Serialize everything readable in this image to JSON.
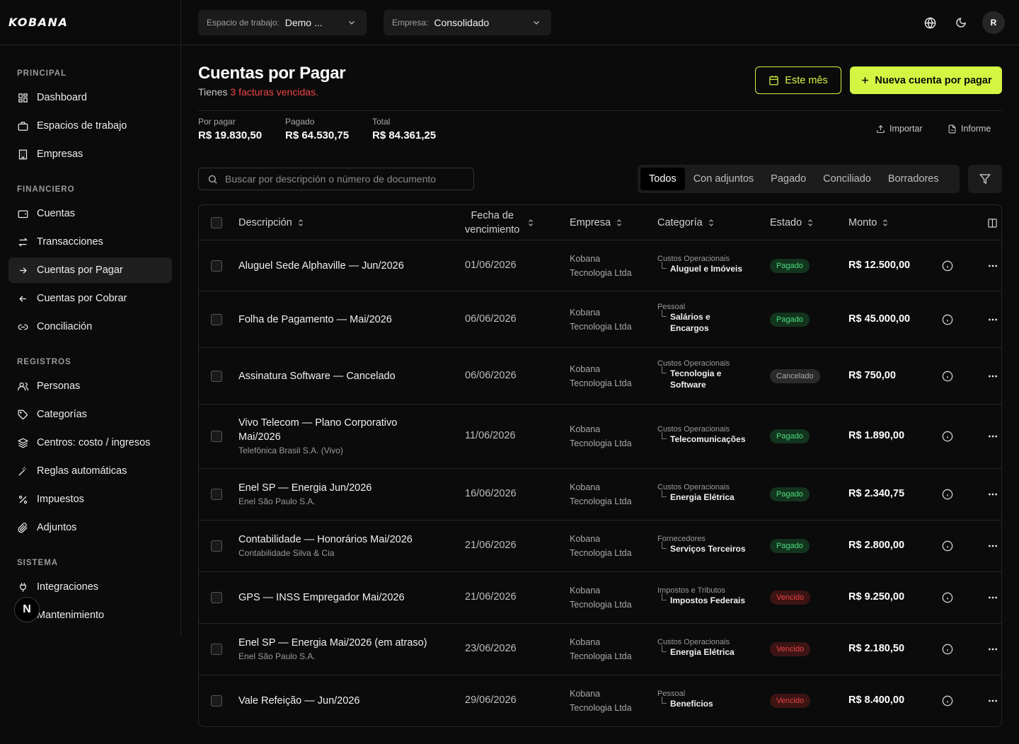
{
  "topbar": {
    "logo": "KOBANA",
    "workspace_label": "Espacio de trabajo:",
    "workspace_value": "Demo ...",
    "company_label": "Empresa:",
    "company_value": "Consolidado",
    "avatar_initial": "R"
  },
  "sidebar": {
    "sections": [
      {
        "title": "PRINCIPAL",
        "items": [
          {
            "label": "Dashboard",
            "icon": "dashboard-icon"
          },
          {
            "label": "Espacios de trabajo",
            "icon": "briefcase-icon"
          },
          {
            "label": "Empresas",
            "icon": "building-icon"
          }
        ]
      },
      {
        "title": "FINANCIERO",
        "items": [
          {
            "label": "Cuentas",
            "icon": "wallet-icon"
          },
          {
            "label": "Transacciones",
            "icon": "transfer-icon"
          },
          {
            "label": "Cuentas por Pagar",
            "icon": "arrow-right-icon",
            "active": true
          },
          {
            "label": "Cuentas por Cobrar",
            "icon": "arrow-left-icon"
          },
          {
            "label": "Conciliación",
            "icon": "link-icon"
          }
        ]
      },
      {
        "title": "REGISTROS",
        "items": [
          {
            "label": "Personas",
            "icon": "users-icon"
          },
          {
            "label": "Categorías",
            "icon": "tag-icon"
          },
          {
            "label": "Centros: costo / ingresos",
            "icon": "layers-icon"
          },
          {
            "label": "Reglas automáticas",
            "icon": "wand-icon"
          },
          {
            "label": "Impuestos",
            "icon": "percent-icon"
          },
          {
            "label": "Adjuntos",
            "icon": "paperclip-icon"
          }
        ]
      },
      {
        "title": "SISTEMA",
        "items": [
          {
            "label": "Integraciones",
            "icon": "plug-icon"
          },
          {
            "label": "Mantenimiento",
            "icon": "wrench-icon"
          }
        ]
      }
    ],
    "badge_letter": "N"
  },
  "main": {
    "title": "Cuentas por Pagar",
    "subtitle_prefix": "Tienes ",
    "subtitle_warn": "3 facturas vencidas.",
    "btn_month": "Este mês",
    "btn_new": "Nueva cuenta por pagar",
    "stats": [
      {
        "label": "Por pagar",
        "value": "R$ 19.830,50"
      },
      {
        "label": "Pagado",
        "value": "R$ 64.530,75"
      },
      {
        "label": "Total",
        "value": "R$ 84.361,25"
      }
    ],
    "import_label": "Importar",
    "report_label": "Informe",
    "search_placeholder": "Buscar por descripción o número de documento",
    "tabs": [
      "Todos",
      "Con adjuntos",
      "Pagado",
      "Conciliado",
      "Borradores"
    ],
    "active_tab": "Todos"
  },
  "table": {
    "headers": {
      "description": "Descripción",
      "due_date_1": "Fecha de",
      "due_date_2": "vencimiento",
      "company": "Empresa",
      "category": "Categoría",
      "status": "Estado",
      "amount": "Monto"
    },
    "rows": [
      {
        "desc": "Aluguel Sede Alphaville — Jun/2026",
        "sub": "",
        "date": "01/06/2026",
        "emp1": "Kobana",
        "emp2": "Tecnologia Ltda",
        "parent": "Custos Operacionais",
        "cat": "Aluguel e Imóveis",
        "status": "Pagado",
        "kind": "pagado",
        "amount": "R$ 12.500,00"
      },
      {
        "desc": "Folha de Pagamento — Mai/2026",
        "sub": "",
        "date": "06/06/2026",
        "emp1": "Kobana",
        "emp2": "Tecnologia Ltda",
        "parent": "Pessoal",
        "cat": "Salários e Encargos",
        "status": "Pagado",
        "kind": "pagado",
        "amount": "R$ 45.000,00"
      },
      {
        "desc": "Assinatura Software — Cancelado",
        "sub": "",
        "date": "06/06/2026",
        "emp1": "Kobana",
        "emp2": "Tecnologia Ltda",
        "parent": "Custos Operacionais",
        "cat": "Tecnologia e Software",
        "status": "Cancelado",
        "kind": "cancelado",
        "amount": "R$ 750,00"
      },
      {
        "desc": "Vivo Telecom — Plano Corporativo Mai/2026",
        "sub": "Telefônica Brasil S.A. (Vivo)",
        "date": "11/06/2026",
        "emp1": "Kobana",
        "emp2": "Tecnologia Ltda",
        "parent": "Custos Operacionais",
        "cat": "Telecomunicações",
        "status": "Pagado",
        "kind": "pagado",
        "amount": "R$ 1.890,00"
      },
      {
        "desc": "Enel SP — Energia Jun/2026",
        "sub": "Enel São Paulo S.A.",
        "date": "16/06/2026",
        "emp1": "Kobana",
        "emp2": "Tecnologia Ltda",
        "parent": "Custos Operacionais",
        "cat": "Energia Elétrica",
        "status": "Pagado",
        "kind": "pagado",
        "amount": "R$ 2.340,75"
      },
      {
        "desc": "Contabilidade — Honorários Mai/2026",
        "sub": "Contabilidade Silva & Cia",
        "date": "21/06/2026",
        "emp1": "Kobana",
        "emp2": "Tecnologia Ltda",
        "parent": "Fornecedores",
        "cat": "Serviços Terceiros",
        "status": "Pagado",
        "kind": "pagado",
        "amount": "R$ 2.800,00"
      },
      {
        "desc": "GPS — INSS Empregador Mai/2026",
        "sub": "",
        "date": "21/06/2026",
        "emp1": "Kobana",
        "emp2": "Tecnologia Ltda",
        "parent": "Impostos e Tributos",
        "cat": "Impostos Federais",
        "status": "Vencido",
        "kind": "vencido",
        "amount": "R$ 9.250,00"
      },
      {
        "desc": "Enel SP — Energia Mai/2026 (em atraso)",
        "sub": "Enel São Paulo S.A.",
        "date": "23/06/2026",
        "emp1": "Kobana",
        "emp2": "Tecnologia Ltda",
        "parent": "Custos Operacionais",
        "cat": "Energia Elétrica",
        "status": "Vencido",
        "kind": "vencido",
        "amount": "R$ 2.180,50"
      },
      {
        "desc": "Vale Refeição — Jun/2026",
        "sub": "",
        "date": "29/06/2026",
        "emp1": "Kobana",
        "emp2": "Tecnologia Ltda",
        "parent": "Pessoal",
        "cat": "Benefícios",
        "status": "Vencido",
        "kind": "vencido",
        "amount": "R$ 8.400,00"
      }
    ]
  },
  "colors": {
    "accent": "#d4f542",
    "danger": "#ef4444",
    "success": "#4ade80"
  }
}
